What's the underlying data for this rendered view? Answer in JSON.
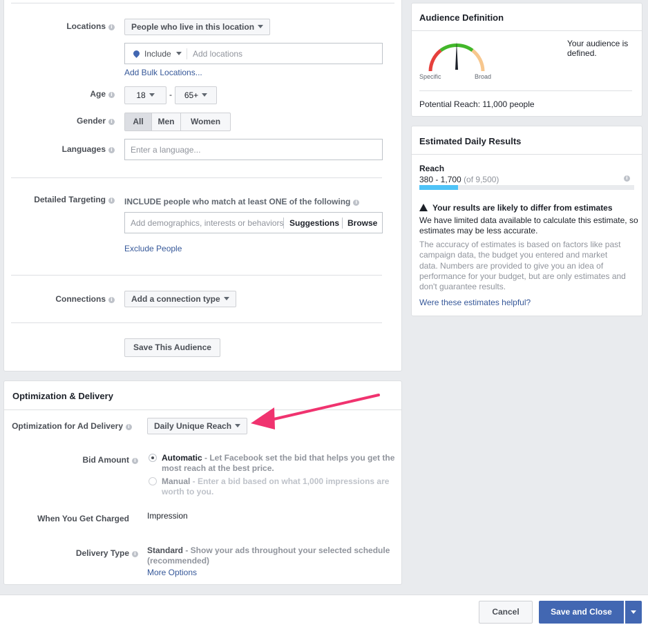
{
  "audience": {
    "locations": {
      "label": "Locations",
      "dropdown": "People who live in this location",
      "include": "Include",
      "placeholder": "Add locations",
      "bulk_link": "Add Bulk Locations..."
    },
    "age": {
      "label": "Age",
      "min": "18",
      "dash": "-",
      "max": "65+"
    },
    "gender": {
      "label": "Gender",
      "options": [
        "All",
        "Men",
        "Women"
      ],
      "selected": "All"
    },
    "languages": {
      "label": "Languages",
      "placeholder": "Enter a language..."
    },
    "detailed": {
      "label": "Detailed Targeting",
      "heading": "INCLUDE people who match at least ONE of the following",
      "placeholder": "Add demographics, interests or behaviors",
      "suggestions": "Suggestions",
      "browse": "Browse",
      "exclude_link": "Exclude People"
    },
    "connections": {
      "label": "Connections",
      "dropdown": "Add a connection type"
    },
    "save_button": "Save This Audience"
  },
  "optimization": {
    "title": "Optimization & Delivery",
    "ad_delivery": {
      "label": "Optimization for Ad Delivery",
      "value": "Daily Unique Reach"
    },
    "bid": {
      "label": "Bid Amount",
      "automatic_title": "Automatic",
      "automatic_desc_1": " - Let Facebook set the bid that helps you get the",
      "automatic_desc_2": "most reach at the best price.",
      "manual_title": "Manual",
      "manual_desc_1": " - Enter a bid based on what 1,000 impressions are",
      "manual_desc_2": "worth to you.",
      "selected": "Automatic"
    },
    "charged": {
      "label": "When You Get Charged",
      "value": "Impression"
    },
    "delivery": {
      "label": "Delivery Type",
      "standard_title": "Standard",
      "desc_1": " - Show your ads throughout your selected schedule",
      "desc_2": "(recommended)",
      "more_link": "More Options"
    }
  },
  "audience_definition": {
    "title": "Audience Definition",
    "specific": "Specific",
    "broad": "Broad",
    "status": "Your audience is defined.",
    "reach": "Potential Reach: 11,000 people"
  },
  "estimated": {
    "title": "Estimated Daily Results",
    "reach_label": "Reach",
    "reach_range": "380 - 1,700",
    "reach_total": "(of 9,500)",
    "reach_fraction": 0.18,
    "warning_title": "Your results are likely to differ from estimates",
    "warning_body": "We have limited data available to calculate this estimate, so estimates may be less accurate.",
    "note": "The accuracy of estimates is based on factors like past campaign data, the budget you entered and market data. Numbers are provided to give you an idea of performance for your budget, but are only estimates and don't guarantee results.",
    "helpful_link": "Were these estimates helpful?"
  },
  "footer": {
    "cancel": "Cancel",
    "save_close": "Save and Close"
  },
  "colors": {
    "primary": "#4267b2",
    "reach_bar": "#4fc3f7",
    "arrow": "#f0336f",
    "link": "#365899"
  }
}
